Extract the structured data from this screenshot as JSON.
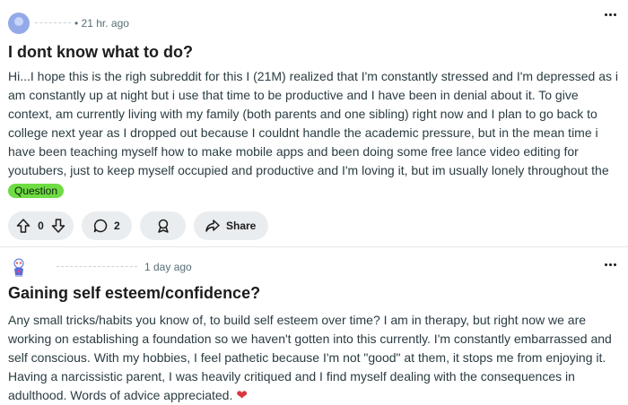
{
  "posts": [
    {
      "timestamp": "• 21 hr. ago",
      "title": "I dont know what to do?",
      "body": "Hi...I hope this is the righ subreddit for this I (21M) realized that I'm constantly stressed and I'm depressed as i am constantly up at night but i use that time to be productive and I have been in denial about it. To give context, am currently living with my family (both parents and one sibling) right now and I plan to go back to college next year as I dropped out because I couldnt handle the academic pressure, but in the mean time i have been teaching myself how to make mobile apps and been doing some free lance video editing for youtubers, just to keep myself occupied and productive and I'm loving it, but im usually lonely throughout the day, as my mom...",
      "flair": "Question",
      "votes": "0",
      "comments": "2",
      "share_label": "Share",
      "flair_color": "#6edc43"
    },
    {
      "timestamp": "1 day ago",
      "title": "Gaining self esteem/confidence?",
      "body": "Any small tricks/habits you know of, to build self esteem over time? I am in therapy, but right now we are working on establishing a foundation so we haven't gotten into this currently. I'm constantly embarrassed and self conscious. With my hobbies, I feel pathetic because I'm not \"good\" at them, it stops me from enjoying it. Having a narcissistic parent, I was heavily critiqued and I find myself dealing with the consequences in adulthood. Words of advice appreciated.",
      "emoji": "❤"
    }
  ],
  "icons": [
    "avatar",
    "more-options-icon",
    "upvote-icon",
    "downvote-icon",
    "comment-icon",
    "award-icon",
    "share-icon",
    "heart-emoji"
  ],
  "colors": {
    "accent_pill": "#eaedef",
    "meta_text": "#576f76",
    "body_text": "#2a3c42"
  }
}
